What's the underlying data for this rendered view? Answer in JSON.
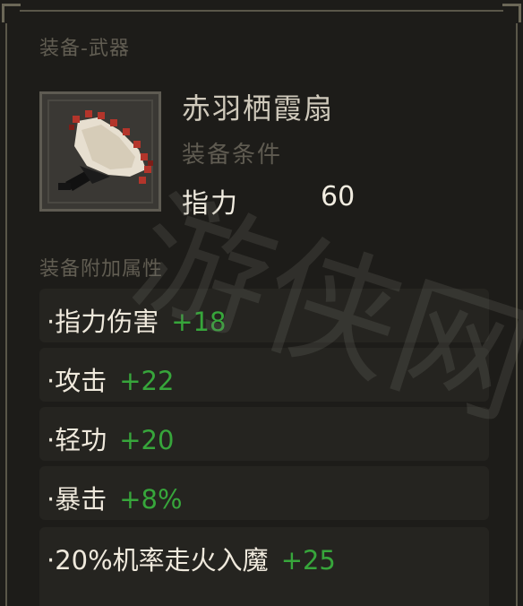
{
  "header": {
    "category": "装备-武器"
  },
  "item": {
    "name": "赤羽栖霞扇",
    "requirement_label": "装备条件",
    "requirement_stat": "指力",
    "requirement_value": "60",
    "icon": "feather-fan-icon"
  },
  "bonus": {
    "label": "装备附加属性",
    "attributes": [
      {
        "name": "·指力伤害",
        "value": "+18"
      },
      {
        "name": "·攻击",
        "value": "+22"
      },
      {
        "name": "·轻功",
        "value": "+20"
      },
      {
        "name": "·暴击",
        "value": "+8%"
      },
      {
        "name": "·20%机率走火入魔",
        "value": "+25"
      }
    ]
  },
  "watermark": "游侠网",
  "colors": {
    "background": "#1d1c19",
    "row_bg": "#252420",
    "bonus_green": "#37a63b",
    "muted_label": "#615d52",
    "frame": "#5a5749"
  }
}
